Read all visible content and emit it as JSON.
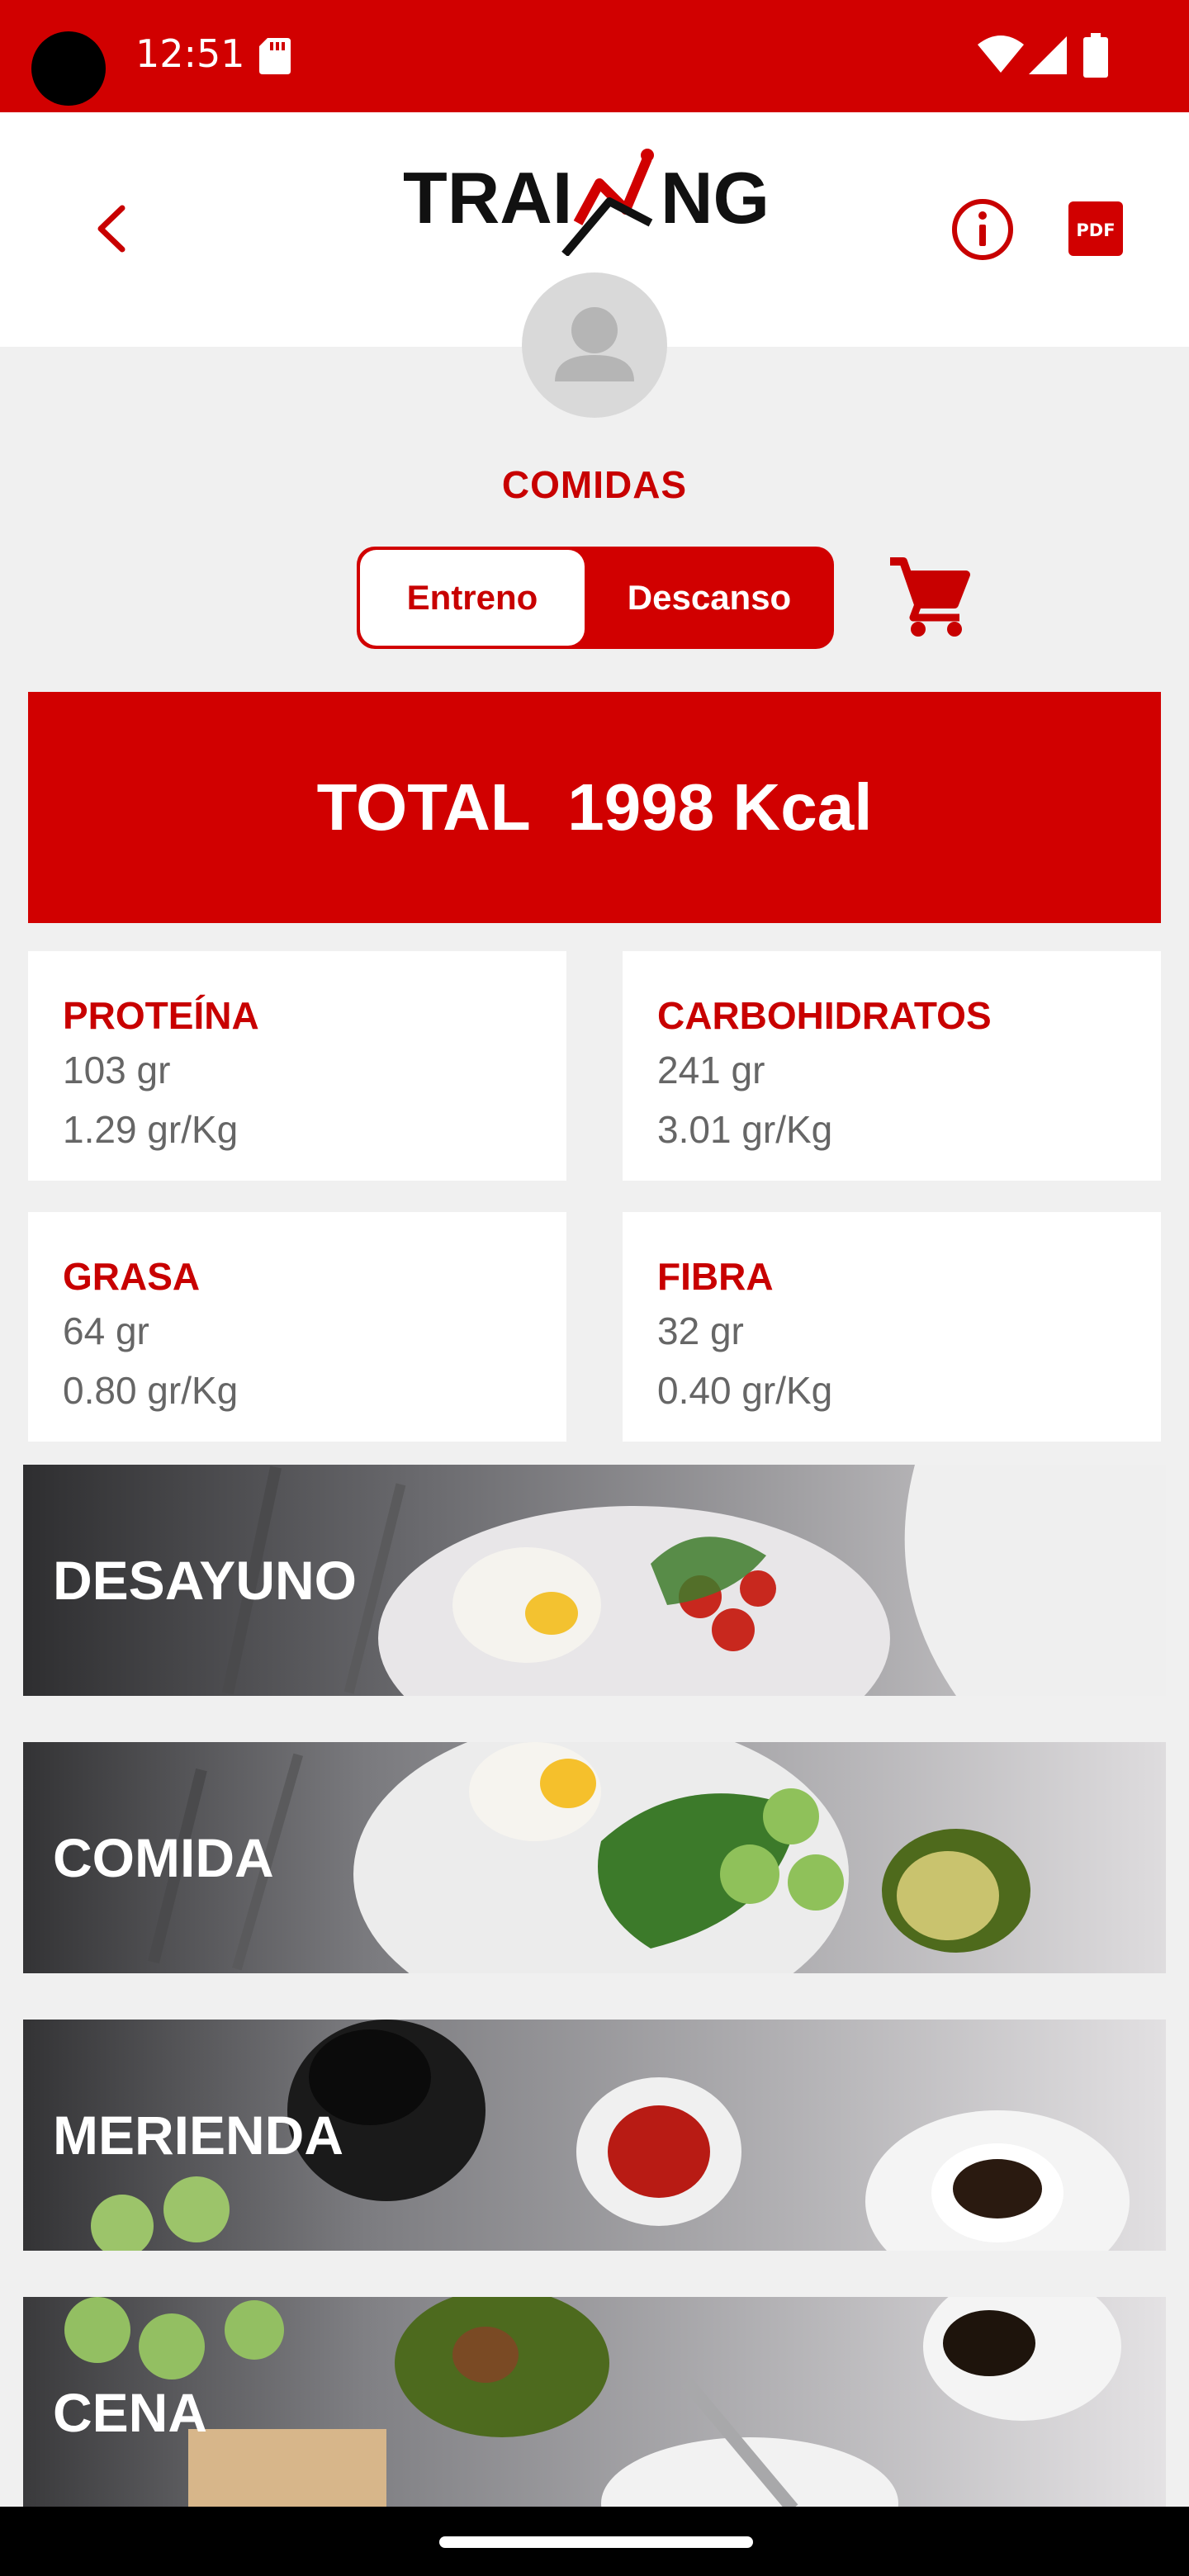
{
  "status_bar": {
    "time": "12:51",
    "background": "#d10000"
  },
  "header": {
    "logo_text": "TRAINING",
    "accent": "#c80000"
  },
  "section_title": "COMIDAS",
  "tabs": [
    {
      "label": "Entreno",
      "selected": true
    },
    {
      "label": "Descanso",
      "selected": false
    }
  ],
  "total": {
    "label": "TOTAL",
    "value": "1998 Kcal"
  },
  "macros": [
    {
      "title": "PROTEÍNA",
      "grams": "103 gr",
      "per_kg": "1.29 gr/Kg"
    },
    {
      "title": "CARBOHIDRATOS",
      "grams": "241 gr",
      "per_kg": "3.01 gr/Kg"
    },
    {
      "title": "GRASA",
      "grams": "64 gr",
      "per_kg": "0.80 gr/Kg"
    },
    {
      "title": "FIBRA",
      "grams": "32 gr",
      "per_kg": "0.40 gr/Kg"
    }
  ],
  "meals": [
    {
      "label": "DESAYUNO"
    },
    {
      "label": "COMIDA"
    },
    {
      "label": "MERIENDA"
    },
    {
      "label": "CENA"
    }
  ],
  "icons": [
    "back-icon",
    "info-icon",
    "pdf-icon",
    "cart-icon",
    "avatar-icon",
    "wifi-icon",
    "signal-icon",
    "battery-icon",
    "sd-card-icon"
  ]
}
